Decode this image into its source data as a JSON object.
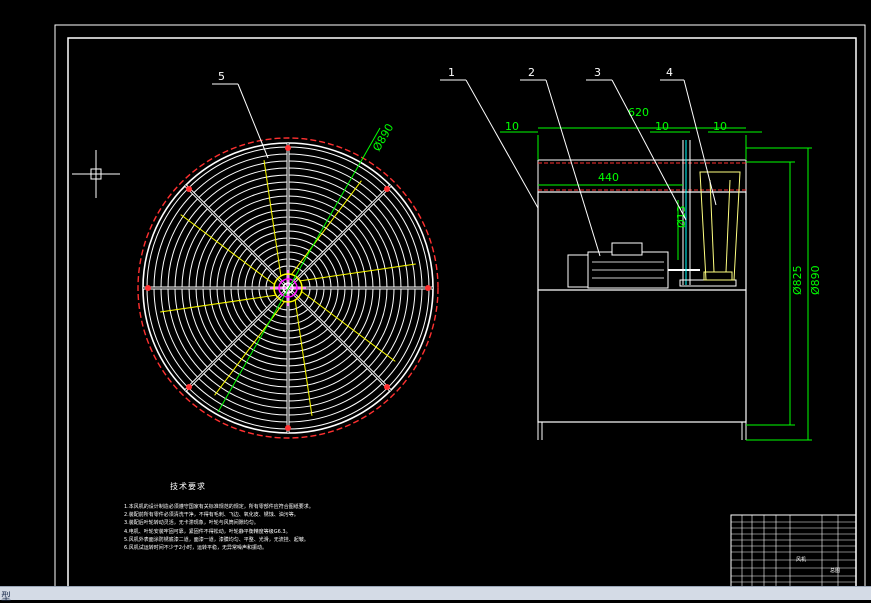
{
  "drawing": {
    "part_labels": [
      "1",
      "2",
      "3",
      "4",
      "5"
    ],
    "dimensions": {
      "d_guard": "Ø890",
      "w_total": "620",
      "w_440": "440",
      "left_10": "10",
      "mid_10": "10",
      "right_10": "10",
      "d_13": "Ø13",
      "d_825": "Ø825",
      "d_890_side": "Ø890"
    },
    "notes_title": "技术要求",
    "notes": [
      "1.本风机的设计制造必须遵守国家有关标准规范的规定，所有零部件应符合图纸要求。",
      "2.装配前所有零件必须清洗干净，不得有毛刺、飞边、氧化皮、锈蚀、油污等。",
      "3.装配后叶轮转动灵活，无卡滞现象，叶轮与风筒间隙均匀。",
      "4.电机、叶轮安装牢固可靠，紧固件不得松动，叶轮静平衡精度等级G6.3。",
      "5.风机外表面涂防锈底漆二道，面漆一道，漆膜均匀、平整、光滑，无流挂、起皱。",
      "6.风机试运转时间不少于2小时，运转平稳，无异常噪声和振动。"
    ],
    "title_block": {
      "label_a": "风机",
      "label_b": "总图"
    },
    "colors": {
      "frame": "#ffffff",
      "dimension": "#00ff00",
      "hidden": "#ff3030",
      "blade": "#ffff00",
      "center": "#ff00ff",
      "motor": "#cccccc",
      "cone": "#ffff80"
    }
  },
  "taskbar": {
    "label": "型"
  }
}
